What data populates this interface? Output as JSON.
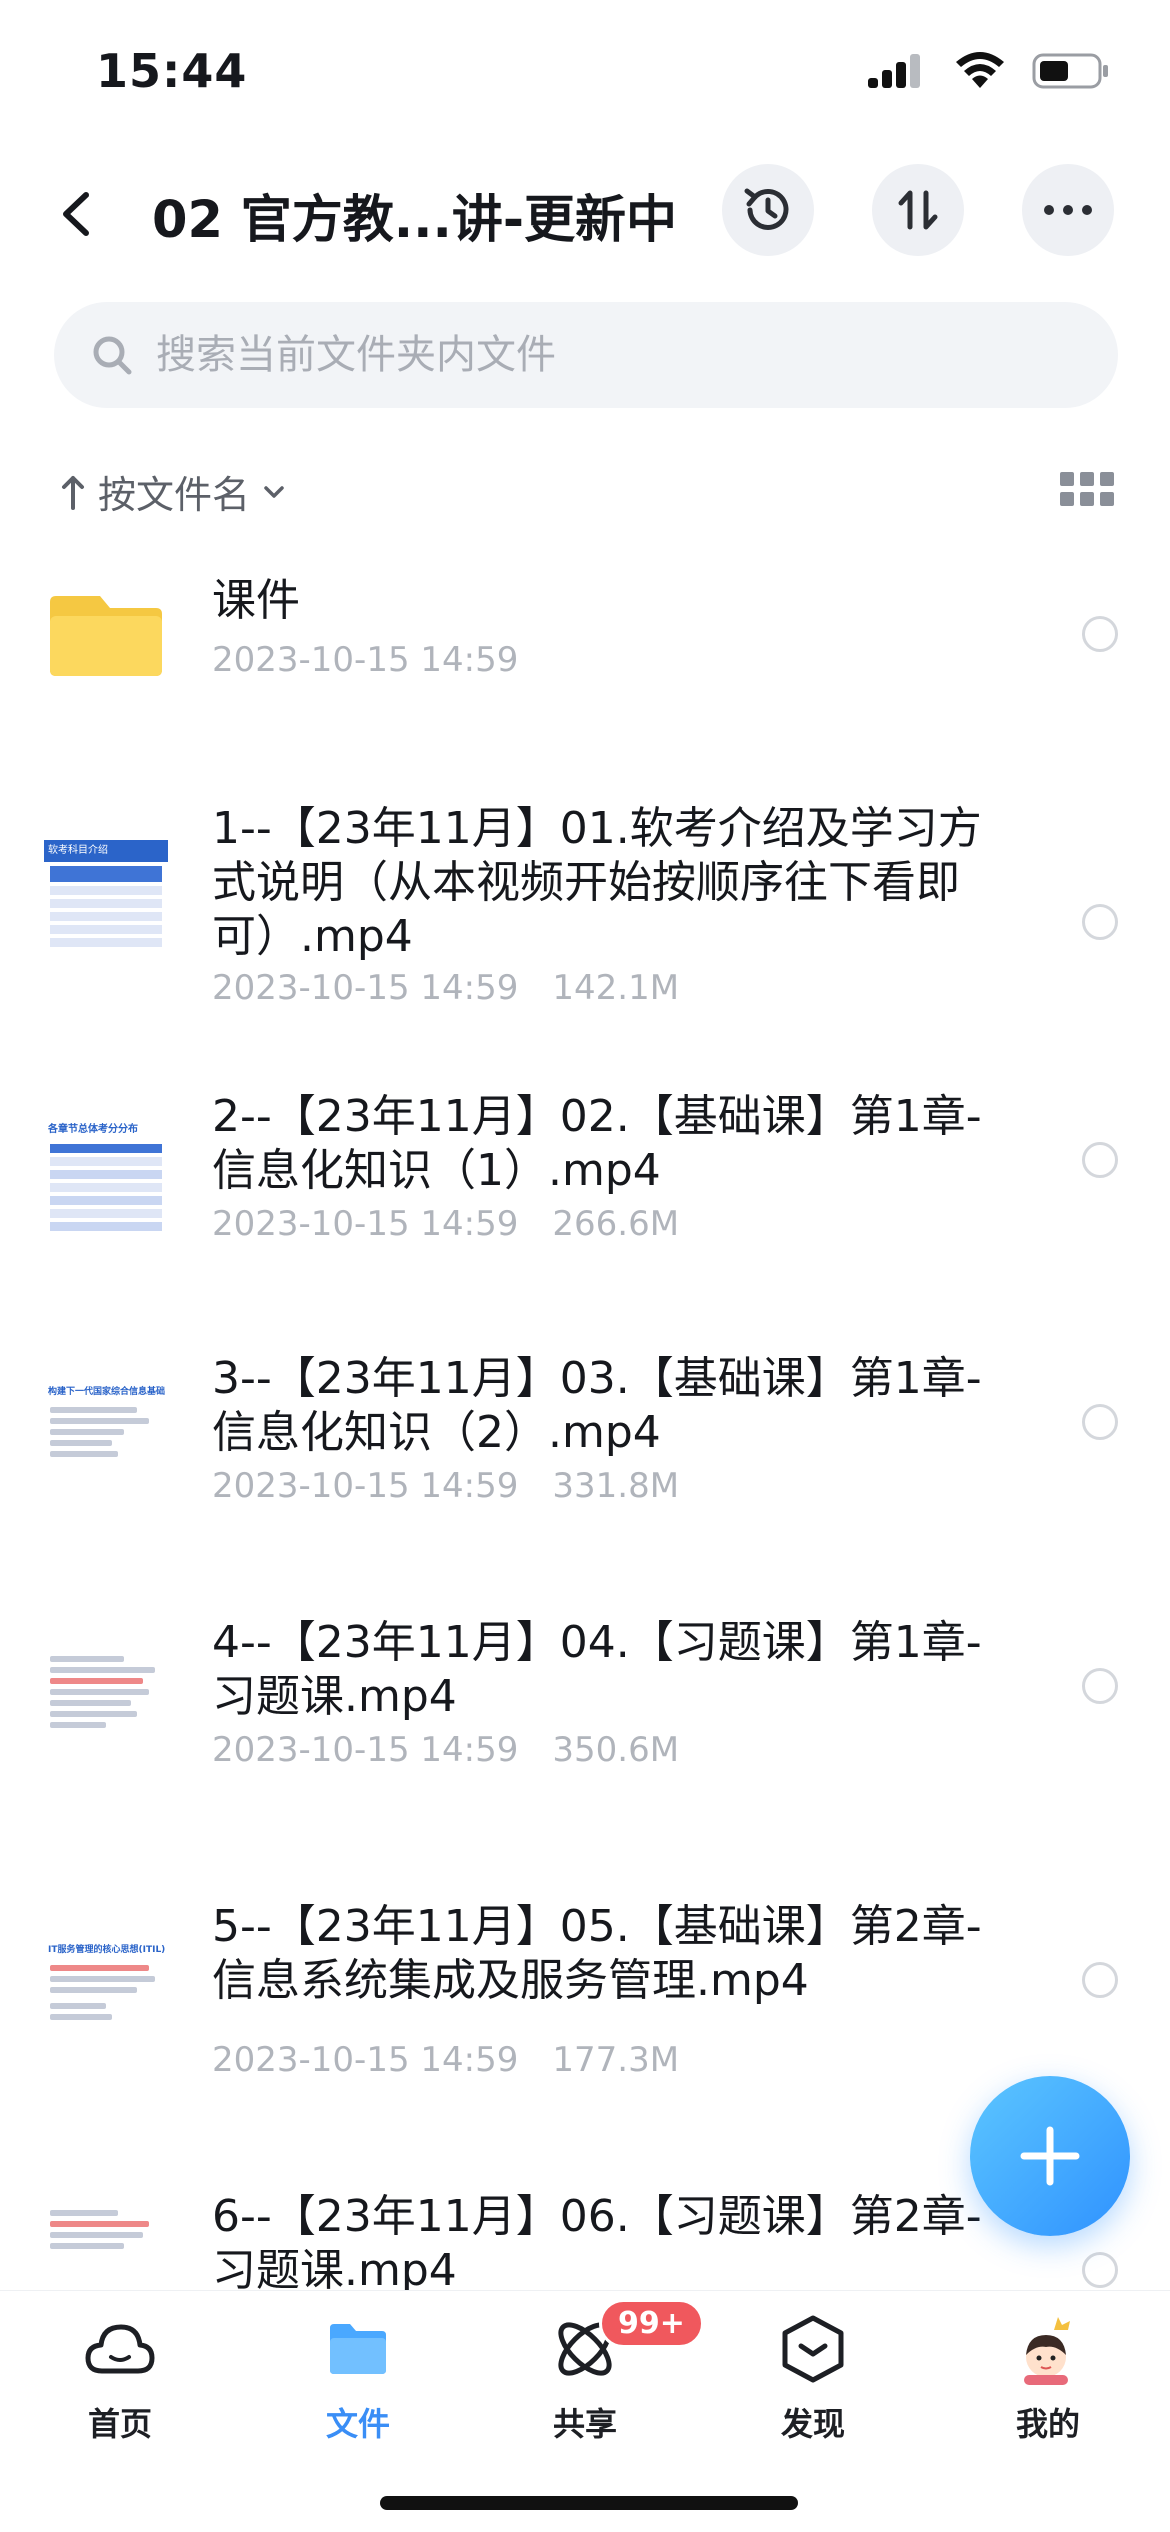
{
  "status_bar": {
    "time": "15:44"
  },
  "header": {
    "title": "02 官方教...讲-更新中"
  },
  "search": {
    "placeholder": "搜索当前文件夹内文件"
  },
  "sort": {
    "label": "按文件名"
  },
  "files": [
    {
      "name": "课件",
      "date": "2023-10-15 14:59",
      "size": ""
    },
    {
      "name": "1--【23年11月】01.软考介绍及学习方式说明（从本视频开始按顺序往下看即可）.mp4",
      "date": "2023-10-15 14:59",
      "size": "142.1M",
      "thumb_title": "软考科目介绍"
    },
    {
      "name": "2--【23年11月】02.【基础课】第1章-信息化知识（1）.mp4",
      "date": "2023-10-15 14:59",
      "size": "266.6M",
      "thumb_title": "各章节总体考分分布"
    },
    {
      "name": "3--【23年11月】03.【基础课】第1章-信息化知识（2）.mp4",
      "date": "2023-10-15 14:59",
      "size": "331.8M",
      "thumb_title": "构建下一代国家综合信息基础"
    },
    {
      "name": "4--【23年11月】04.【习题课】第1章-习题课.mp4",
      "date": "2023-10-15 14:59",
      "size": "350.6M"
    },
    {
      "name": "5--【23年11月】05.【基础课】第2章-信息系统集成及服务管理.mp4",
      "date": "2023-10-15 14:59",
      "size": "177.3M",
      "thumb_title": "IT服务管理的核心思想(ITIL)"
    },
    {
      "name": "6--【23年11月】06.【习题课】第2章-习题课.mp4",
      "date": "",
      "size": ""
    }
  ],
  "tabs": [
    {
      "label": "首页",
      "icon": "cloud-icon"
    },
    {
      "label": "文件",
      "icon": "folder-icon"
    },
    {
      "label": "共享",
      "icon": "share-icon"
    },
    {
      "label": "发现",
      "icon": "discover-icon"
    },
    {
      "label": "我的",
      "icon": "avatar-icon"
    }
  ],
  "share_badge": "99+",
  "colors": {
    "accent": "#3a8ef6",
    "folder": "#fcd85e",
    "badge": "#f0585d",
    "meta": "#b0b4bb"
  }
}
